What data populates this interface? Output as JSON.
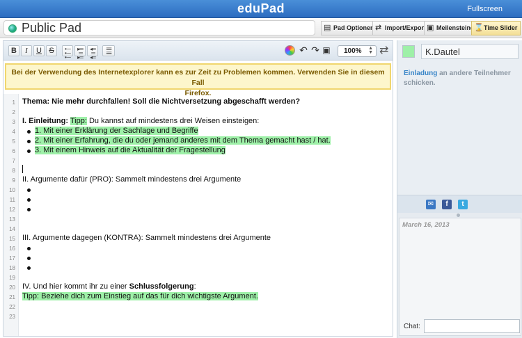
{
  "app": {
    "title": "eduPad",
    "fullscreen_label": "Fullscreen"
  },
  "pad": {
    "title": "Public Pad"
  },
  "top_actions": [
    {
      "label": "Pad Optionen",
      "icon": "document-icon"
    },
    {
      "label": "Import/Export",
      "icon": "import-export-icon"
    },
    {
      "label": "Meilensteine",
      "icon": "save-icon"
    },
    {
      "label": "Time Slider",
      "icon": "time-slider-icon"
    }
  ],
  "format_toolbar": {
    "bold": "B",
    "italic": "I",
    "underline": "U",
    "strike": "S",
    "zoom": "100%"
  },
  "warning": {
    "line1": "Bei der Verwendung des Internetexplorer kann es zur Zeit zu Problemen kommen. Verwenden Sie in diesem Fall",
    "line2": "Firefox."
  },
  "editor": {
    "line_numbers": [
      "1",
      "2",
      "3",
      "4",
      "5",
      "6",
      "7",
      "8",
      "9",
      "10",
      "11",
      "12",
      "13",
      "14",
      "15",
      "16",
      "17",
      "18",
      "19",
      "20",
      "21",
      "22",
      "23"
    ],
    "l1": "Thema: Nie mehr durchfallen! Soll die Nichtversetzung abgeschafft werden?",
    "l3_bold": "I. Einleitung:",
    "l3_hl": "Tipp:",
    "l3_rest": "Du kannst auf mindestens drei Weisen einsteigen:",
    "l4": "1. Mit einer Erklärung der Sachlage und Begriffe",
    "l5": "2. Mit einer Erfahrung, die du oder jemand anderes mit dem Thema gemacht hast / hat.",
    "l6": "3. Mit einem Hinweis auf die Aktualität der Fragestellung",
    "l9": "II. Argumente dafür (PRO): Sammelt mindestens drei Argumente",
    "l15": "III. Argumente dagegen (KONTRA): Sammelt mindestens drei Argumente",
    "l20_pre": "IV. Und hier kommt ihr zu einer",
    "l20_bold": "Schlussfolgerung",
    "l20_post": ":",
    "l21": "Tipp: Beziehe dich zum Einstieg auf das für dich wichtigste Argument."
  },
  "user": {
    "name": "K.Dautel",
    "color": "#9ef0a8"
  },
  "invite": {
    "link": "Einladung",
    "rest": "an andere Teilnehmer schicken."
  },
  "chat": {
    "date": "March 16, 2013",
    "label": "Chat:"
  }
}
